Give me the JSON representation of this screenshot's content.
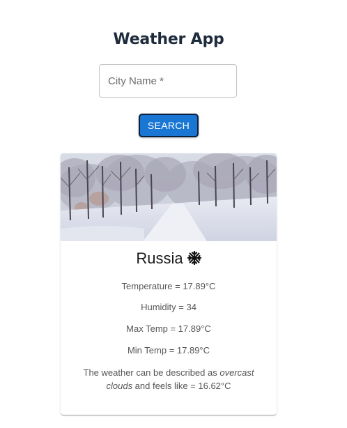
{
  "app": {
    "title": "Weather App"
  },
  "search": {
    "placeholder": "City Name *",
    "value": "",
    "button_label": "SEARCH"
  },
  "card": {
    "image_alt": "Snow-covered park with bare trees",
    "country": "Russia",
    "weather_icon": "snowflake-icon",
    "temperature": "Temperature = 17.89°C",
    "humidity": "Humidity = 34",
    "max_temp": "Max Temp = 17.89°C",
    "min_temp": "Min Temp = 17.89°C",
    "description_prefix": "The weather can be described as ",
    "description_condition": "overcast clouds",
    "description_suffix": " and feels like = 16.62°C"
  },
  "colors": {
    "title": "#1d2b3d",
    "button_bg": "#1976d2",
    "button_border": "#0b1f3a",
    "text_muted": "#555555"
  }
}
